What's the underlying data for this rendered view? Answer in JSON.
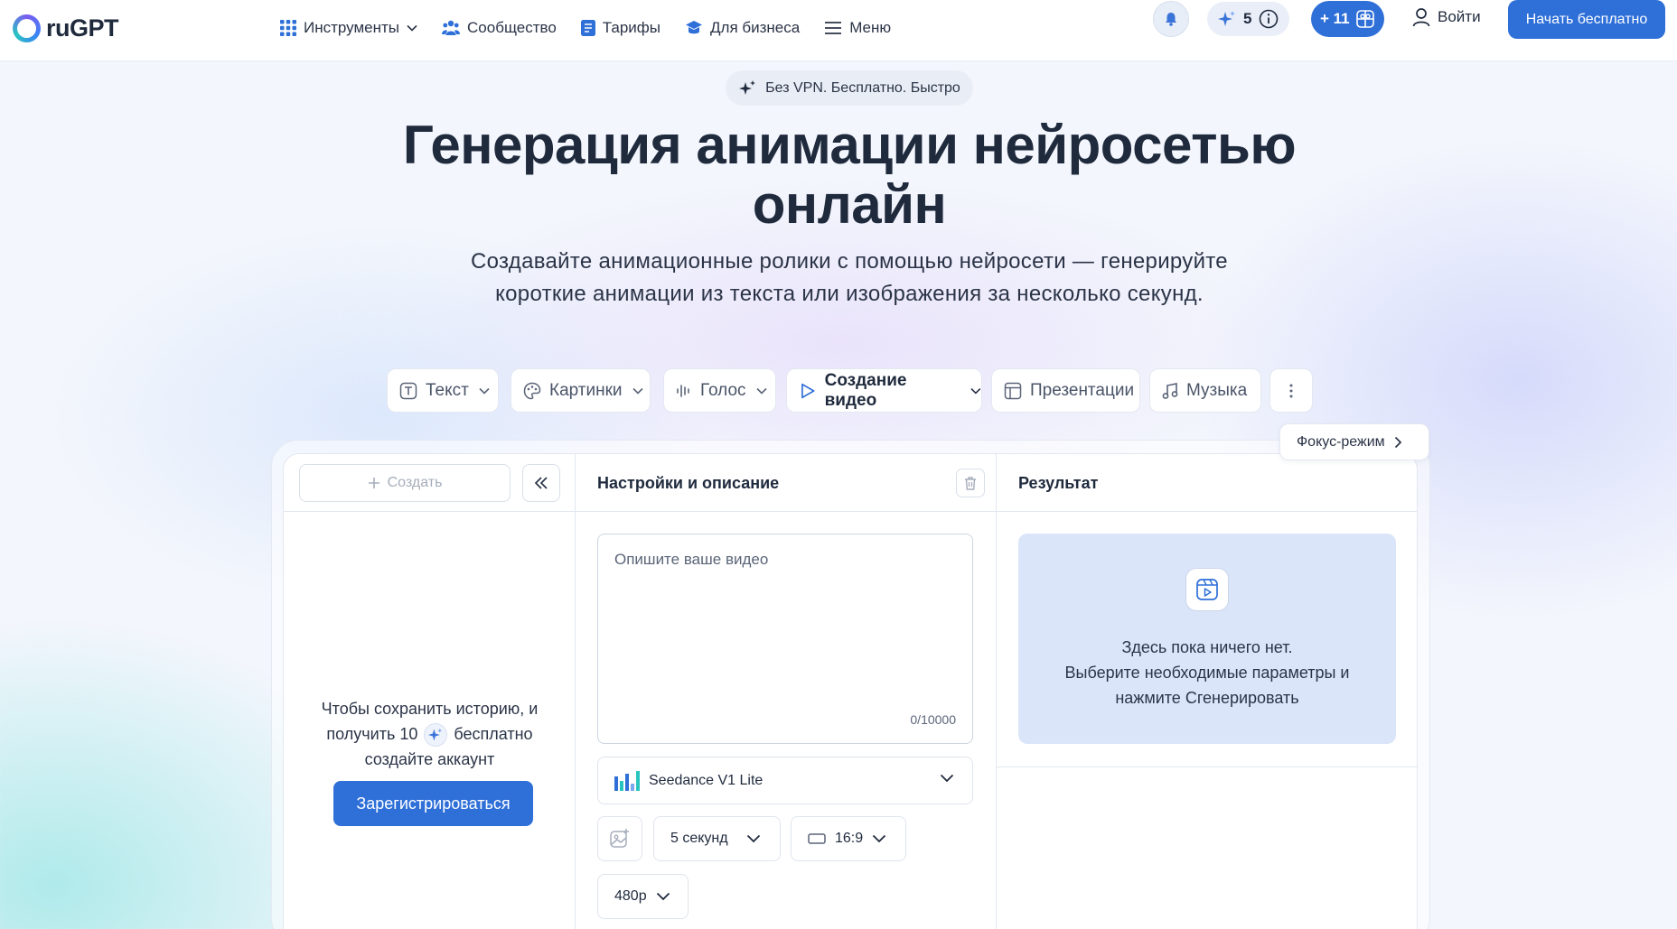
{
  "brand": {
    "name": "ruGPT"
  },
  "nav": {
    "items": [
      {
        "label": "Инструменты",
        "icon": "grid-icon"
      },
      {
        "label": "Сообщество",
        "icon": "community-icon"
      },
      {
        "label": "Тарифы",
        "icon": "tariffs-icon"
      },
      {
        "label": "Для бизнеса",
        "icon": "business-icon"
      },
      {
        "label": "Меню",
        "icon": "menu-icon"
      }
    ]
  },
  "header": {
    "credits": "5",
    "bonus": "+ 11",
    "login": "Войти",
    "start": "Начать бесплатно"
  },
  "hero": {
    "badge": "Без VPN. Бесплатно. Быстро",
    "title_line1": "Генерация анимации нейросетью",
    "title_line2": "онлайн",
    "subtitle_line1": "Создавайте анимационные ролики с помощью нейросети — генерируйте",
    "subtitle_line2": "короткие анимации из текста или изображения за несколько секунд."
  },
  "tabs": [
    {
      "label": "Текст"
    },
    {
      "label": "Картинки"
    },
    {
      "label": "Голос"
    },
    {
      "label": "Создание видео"
    },
    {
      "label": "Презентации"
    },
    {
      "label": "Музыка"
    }
  ],
  "focus_mode": "Фокус-режим",
  "history": {
    "create": "Создать",
    "save_line1": "Чтобы сохранить историю, и",
    "save_line2a": "получить 10",
    "save_line2b": "бесплатно",
    "save_line3": "создайте аккаунт",
    "register": "Зарегистрироваться"
  },
  "settings": {
    "title": "Настройки и описание",
    "placeholder": "Опишите ваше видео",
    "counter": "0/10000",
    "model": "Seedance V1 Lite",
    "duration": "5 секунд",
    "ratio": "16:9",
    "resolution": "480p"
  },
  "result": {
    "title": "Результат",
    "empty_line1": "Здесь пока ничего нет.",
    "empty_line2": "Выберите необходимые параметры и",
    "empty_line3": "нажмите Сгенерировать"
  },
  "colors": {
    "accent": "#2e6fd8",
    "text": "#1f2a3d",
    "result_bg": "#dbe5fa"
  }
}
